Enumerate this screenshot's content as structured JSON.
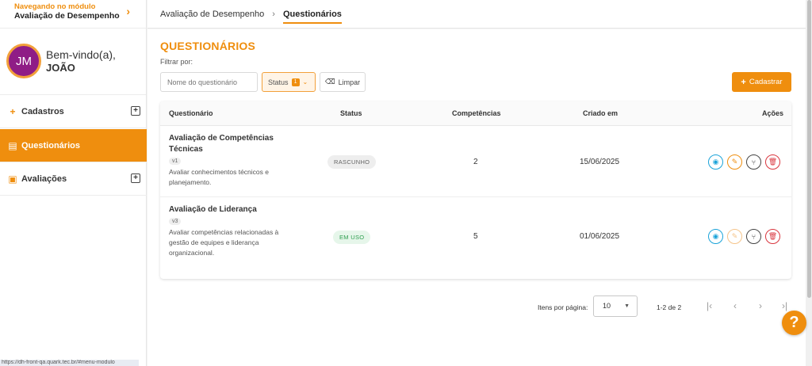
{
  "module": {
    "kicker": "Navegando no módulo",
    "name": "Avaliação de Desempenho"
  },
  "user": {
    "initials": "JM",
    "greeting": "Bem-vindo(a),",
    "name": "JOÃO"
  },
  "nav": [
    {
      "label": "Cadastros",
      "icon": "plus-icon"
    },
    {
      "label": "Questionários",
      "icon": "document-icon"
    },
    {
      "label": "Avaliações",
      "icon": "clipboard-check-icon"
    }
  ],
  "breadcrumb": {
    "parent": "Avaliação de Desempenho",
    "current": "Questionários"
  },
  "page": {
    "title": "QUESTIONÁRIOS",
    "filter_label": "Filtrar por:"
  },
  "filters": {
    "name_placeholder": "Nome do questionário",
    "status_label": "Status",
    "status_count": "1",
    "clear_label": "Limpar",
    "add_label": "Cadastrar"
  },
  "table": {
    "headers": {
      "q": "Questionário",
      "status": "Status",
      "comp": "Competências",
      "created": "Criado em",
      "actions": "Ações"
    },
    "rows": [
      {
        "title": "Avaliação de Competências Técnicas",
        "version": "v1",
        "description": "Avaliar conhecimentos técnicos e planejamento.",
        "status": "RASCUNHO",
        "competencias": "2",
        "created": "15/06/2025"
      },
      {
        "title": "Avaliação de Liderança",
        "version": "v3",
        "description": "Avaliar competências relacionadas à gestão de equipes e liderança organizacional.",
        "status": "EM USO",
        "competencias": "5",
        "created": "01/06/2025"
      }
    ]
  },
  "pagination": {
    "per_page_label": "Itens por página:",
    "per_page": "10",
    "range": "1-2 de 2"
  },
  "status_url": "https://dh-front-qa.quark.tec.br/#menu-modulo",
  "colors": {
    "accent": "#ef8e0e",
    "view": "#1aa3d9",
    "delete": "#d9363e",
    "in_use": "#2e9e4f"
  }
}
